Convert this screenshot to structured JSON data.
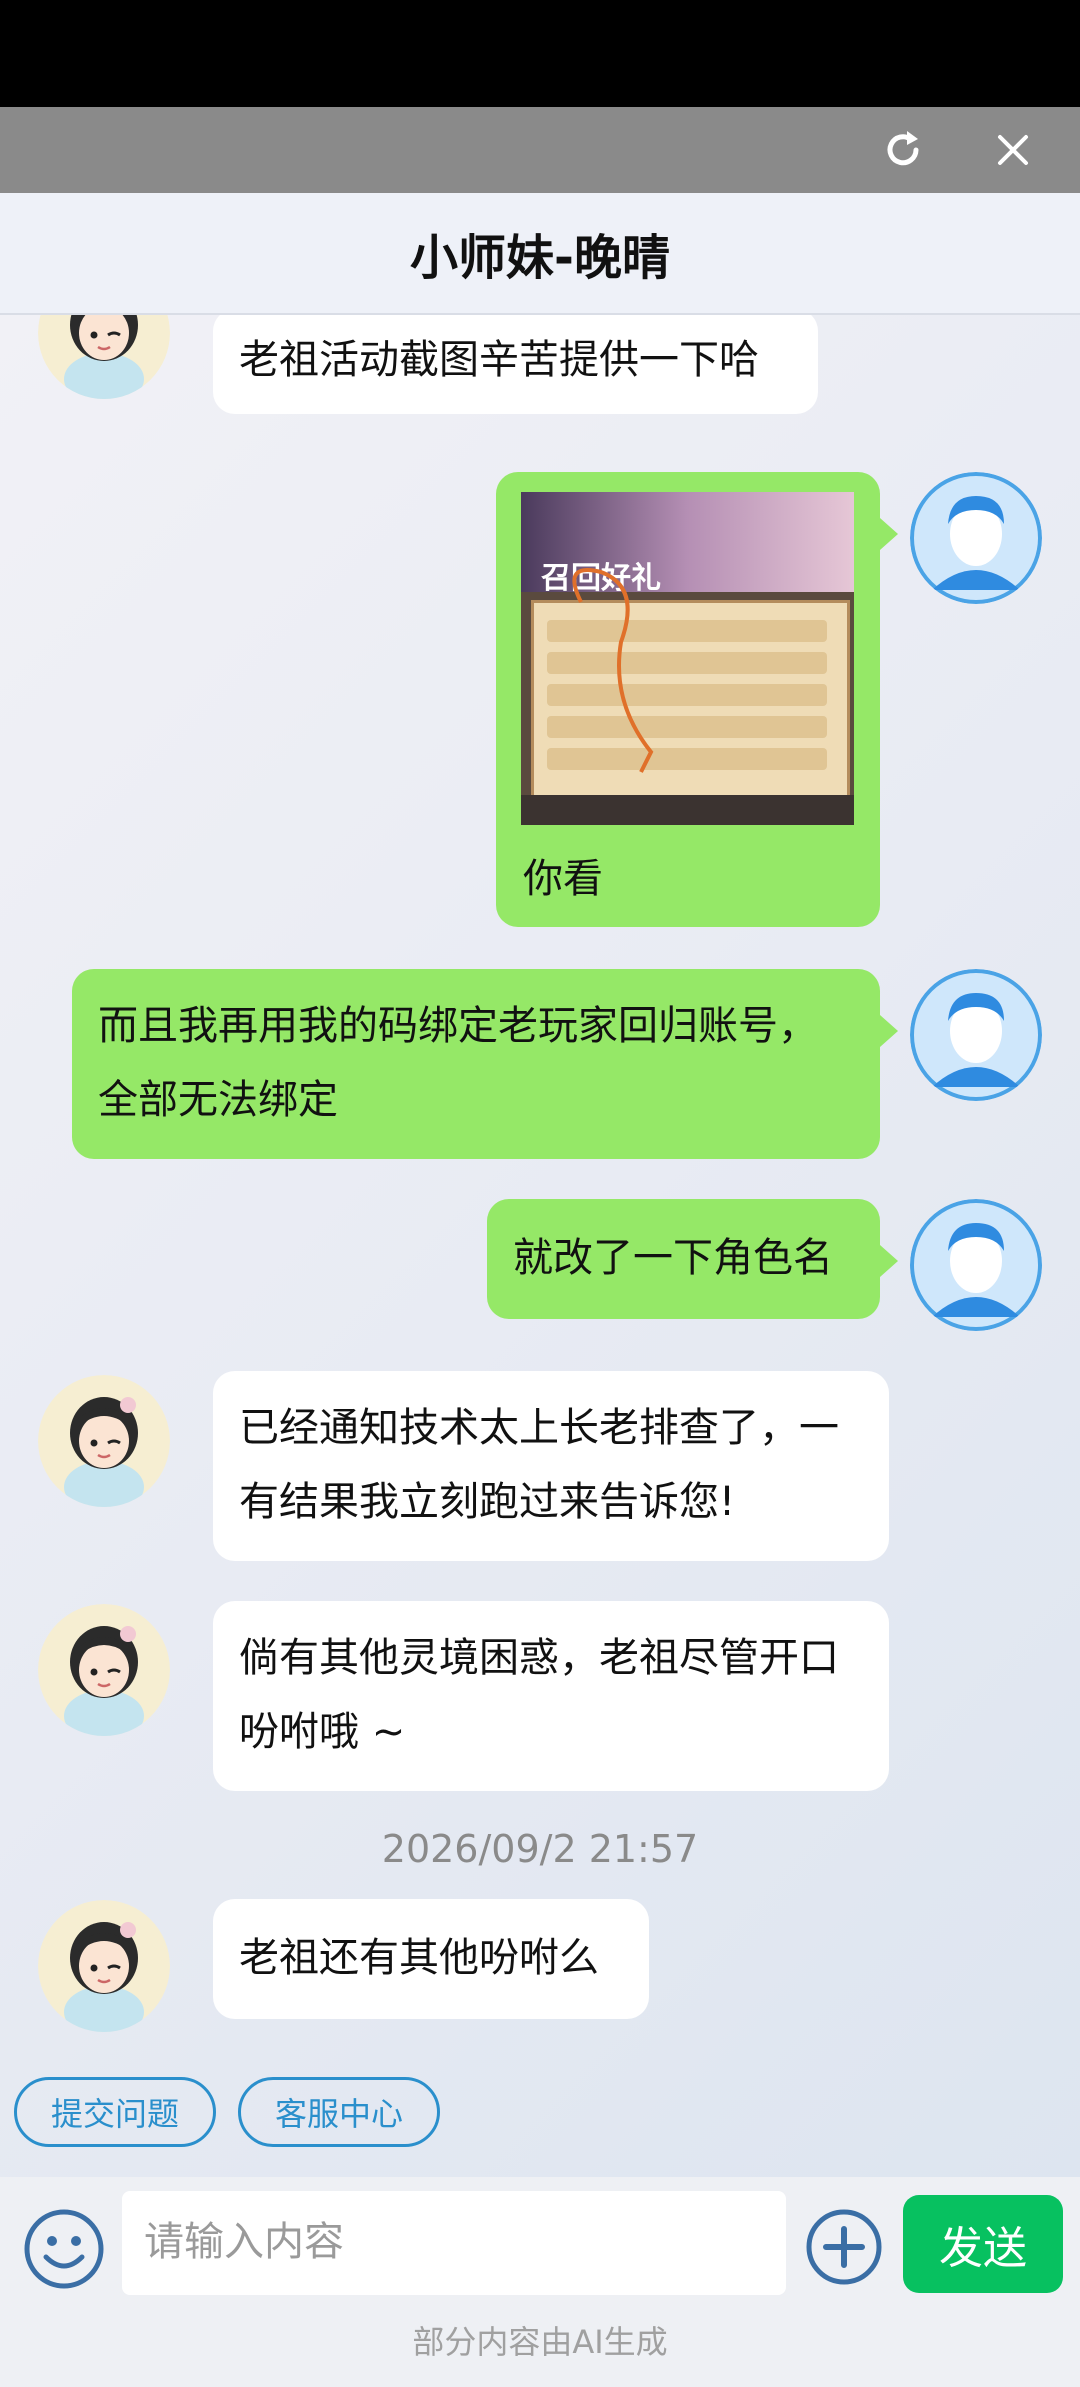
{
  "title": "小师妹-晚晴",
  "messages": [
    {
      "side": "in",
      "text": "老祖活动截图辛苦提供一下哈"
    },
    {
      "side": "out",
      "caption": "你看",
      "game_title": "召回好礼"
    },
    {
      "side": "out",
      "text": "而且我再用我的码绑定老玩家回归账号，全部无法绑定"
    },
    {
      "side": "out",
      "text": "就改了一下角色名"
    },
    {
      "side": "in",
      "text": "已经通知技术太上长老排查了，一有结果我立刻跑过来告诉您!"
    },
    {
      "side": "in",
      "text": "倘有其他灵境困惑，老祖尽管开口吩咐哦 ~"
    },
    {
      "side": "in",
      "text": "老祖还有其他吩咐么"
    }
  ],
  "timestamp": "2026/09/2 21:57",
  "quick_actions": [
    "提交问题",
    "客服中心"
  ],
  "composer": {
    "placeholder": "请输入内容",
    "send_label": "发送"
  },
  "footer_note": "部分内容由AI生成",
  "colors": {
    "outgoing_bubble": "#95e867",
    "send_button": "#07c160",
    "link_blue": "#2a8fcc"
  }
}
